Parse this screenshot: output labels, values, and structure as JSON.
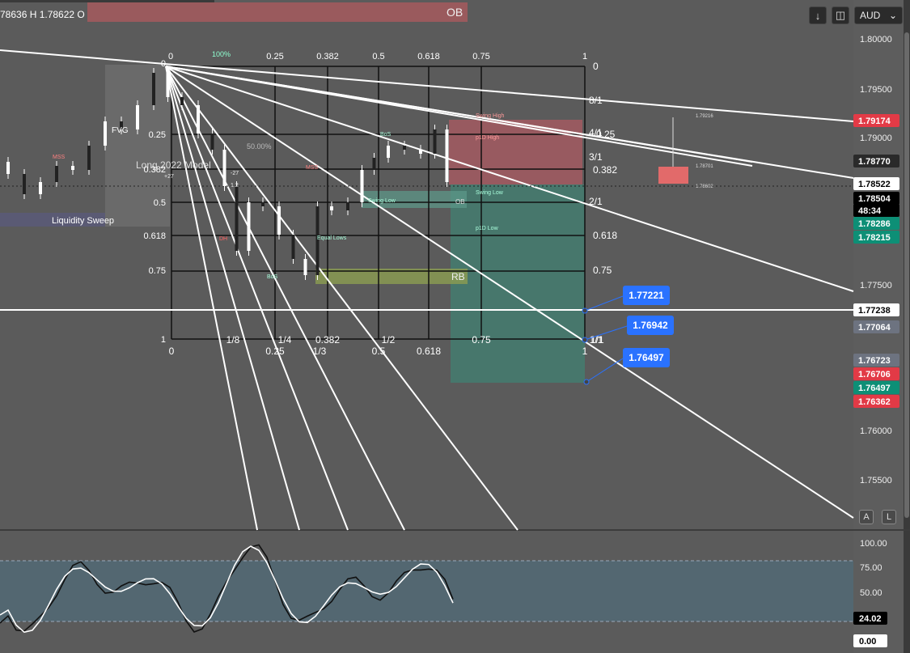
{
  "ohlc": {
    "text": "78636 H 1.78622 O"
  },
  "toolbar": {
    "download_icon": "arrow-down-icon",
    "camera_icon": "camera-icon",
    "currency": "AUD"
  },
  "zone_labels": {
    "ob_top": "OB",
    "ob_mid": "OB",
    "rb": "RB"
  },
  "model_label": "Long 2022 Model",
  "liquidity_label": "Liquidity Sweep",
  "fvg_label": "FVG",
  "pct_100": "100%",
  "pct_50": "50.00%",
  "fib_top": [
    "0.25",
    "0.382",
    "0.5",
    "0.618",
    "0.75",
    "1"
  ],
  "fib_bottom": [
    "0",
    "1/8",
    "0.25",
    "1/4",
    "1/3",
    "0.382",
    "0.5",
    "1/2",
    "0.618",
    "0.75",
    "1",
    "1/1"
  ],
  "fib_left": [
    "0",
    "0.25",
    "0.382",
    "0.5",
    "0.618",
    "0.75",
    "1"
  ],
  "fib_right": [
    "0",
    "8/1",
    "4/1",
    "0.25",
    "3/1",
    "0.382",
    "2/1",
    "0.618",
    "0.75",
    "1/1"
  ],
  "small_labels": {
    "mss1": "MSS",
    "mss2": "MSS",
    "swing_high": "Swing High",
    "swing_low": "Swing Low",
    "swing_low2": "Swing Low",
    "equal_lows": "Equal Lows",
    "p1d_high": "p1D High",
    "p1d_low": "p1D Low",
    "dh": "DH",
    "bos1": "BoS",
    "bos2": "BoS",
    "m27": "-27",
    "p27": "+27",
    "one_two": "1.2"
  },
  "mini_vals": [
    "1.79216",
    "1.78701",
    "1.78602"
  ],
  "price_axis": [
    "1.80000",
    "1.79500",
    "1.79000",
    "1.77500",
    "1.76000",
    "1.75500"
  ],
  "price_tags": [
    {
      "value": "1.79174",
      "color": "#e23a46"
    },
    {
      "value": "1.78770",
      "color": "#2a2a2a"
    },
    {
      "value": "1.78522",
      "color": "#ffffff"
    },
    {
      "value": "1.78504",
      "color": "#000000"
    },
    {
      "value": "48:34",
      "color": "#000000"
    },
    {
      "value": "1.78286",
      "color": "#0d8f76"
    },
    {
      "value": "1.78215",
      "color": "#0d8f76"
    },
    {
      "value": "1.77238",
      "color": "#ffffff"
    },
    {
      "value": "1.77064",
      "color": "#6d7380"
    },
    {
      "value": "1.76723",
      "color": "#6d7380"
    },
    {
      "value": "1.76706",
      "color": "#e23a46"
    },
    {
      "value": "1.76497",
      "color": "#0d8f76"
    },
    {
      "value": "1.76362",
      "color": "#e23a46"
    }
  ],
  "callouts": [
    "1.77221",
    "1.76942",
    "1.76497"
  ],
  "osc_axis": [
    "100.00",
    "75.00",
    "50.00"
  ],
  "osc_tags": [
    {
      "value": "24.02",
      "color": "#000000"
    },
    {
      "value": "0.00",
      "color": "#ffffff"
    }
  ],
  "axis_buttons": [
    "A",
    "L"
  ]
}
